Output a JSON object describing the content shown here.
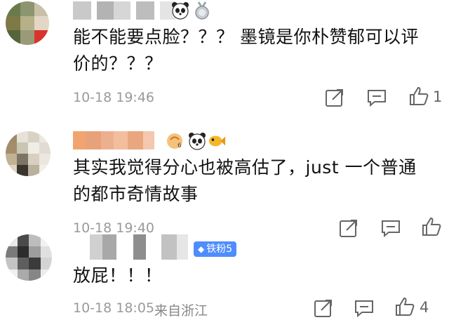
{
  "comments": [
    {
      "text_lines": [
        "能不能要点脸？？？ 墨镜是你朴赞郁可以评",
        "价的？？？"
      ],
      "timestamp": "10-18 19:46",
      "location": "",
      "like_count": "1",
      "badges": [
        "panda-emoji",
        "medal-emoji"
      ]
    },
    {
      "text_lines": [
        "其实我觉得分心也被高估了，just 一个普通",
        "的都市奇情故事"
      ],
      "timestamp": "10-18 19:40",
      "location": "",
      "like_count": "",
      "badges": [
        "badge-icon",
        "panda-emoji",
        "fish-emoji"
      ]
    },
    {
      "text_lines": [
        "放屁！！！"
      ],
      "timestamp": "10-18 18:05",
      "location": "来自浙江",
      "like_count": "4",
      "fan_badge": {
        "diamond": "◆",
        "label": "铁粉5"
      }
    }
  ],
  "colors": {
    "meta": "#9a9a9a",
    "fan_badge": "#4f8dfd"
  },
  "icons": [
    "share-icon",
    "comment-icon",
    "like-icon"
  ]
}
